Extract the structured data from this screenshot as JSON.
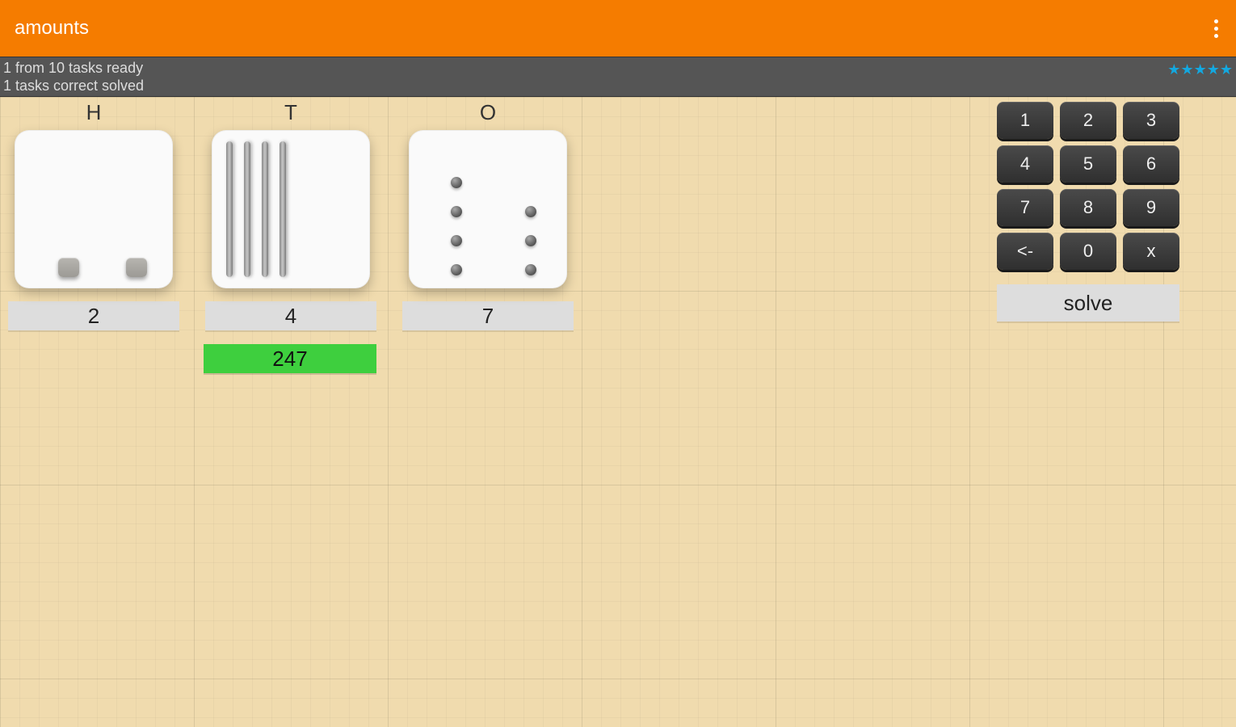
{
  "header": {
    "title": "amounts"
  },
  "status": {
    "line1": "1 from 10 tasks ready",
    "line2": "1 tasks correct solved",
    "stars": 5
  },
  "columns": {
    "hundreds": {
      "label": "H",
      "value": "2"
    },
    "tens": {
      "label": "T",
      "value": "4"
    },
    "ones": {
      "label": "O",
      "value": "7"
    }
  },
  "answer": "247",
  "keypad": {
    "k1": "1",
    "k2": "2",
    "k3": "3",
    "k4": "4",
    "k5": "5",
    "k6": "6",
    "k7": "7",
    "k8": "8",
    "k9": "9",
    "back": "<-",
    "k0": "0",
    "clear": "x",
    "solve": "solve"
  }
}
